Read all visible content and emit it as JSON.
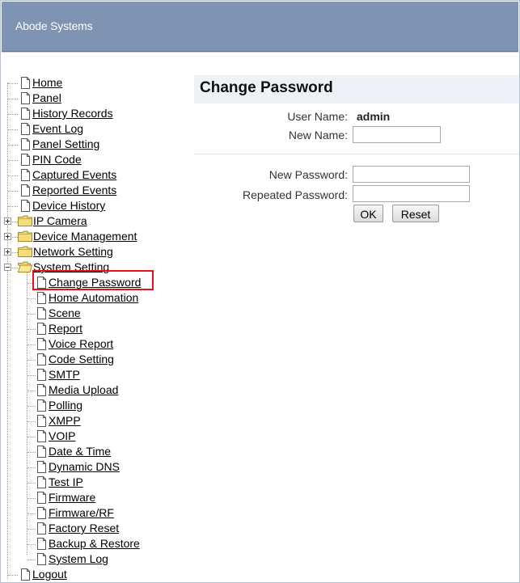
{
  "header": {
    "brand": "Abode Systems"
  },
  "tree": {
    "items": [
      {
        "label": "Home"
      },
      {
        "label": "Panel"
      },
      {
        "label": "History Records"
      },
      {
        "label": "Event Log"
      },
      {
        "label": "Panel Setting"
      },
      {
        "label": "PIN Code"
      },
      {
        "label": "Captured Events"
      },
      {
        "label": "Reported Events"
      },
      {
        "label": "Device History"
      },
      {
        "label": "IP Camera"
      },
      {
        "label": "Device Management"
      },
      {
        "label": "Network Setting"
      },
      {
        "label": "System Setting"
      }
    ],
    "children": [
      {
        "label": "Change Password"
      },
      {
        "label": "Home Automation"
      },
      {
        "label": "Scene"
      },
      {
        "label": "Report"
      },
      {
        "label": "Voice Report"
      },
      {
        "label": "Code Setting"
      },
      {
        "label": "SMTP"
      },
      {
        "label": "Media Upload"
      },
      {
        "label": "Polling"
      },
      {
        "label": "XMPP"
      },
      {
        "label": "VOIP"
      },
      {
        "label": "Date & Time"
      },
      {
        "label": "Dynamic DNS"
      },
      {
        "label": "Test IP"
      },
      {
        "label": "Firmware"
      },
      {
        "label": "Firmware/RF"
      },
      {
        "label": "Factory Reset"
      },
      {
        "label": "Backup & Restore"
      },
      {
        "label": "System Log"
      }
    ],
    "last": {
      "label": "Logout"
    }
  },
  "form": {
    "title": "Change Password",
    "user_name_label": "User Name:",
    "user_name_value": "admin",
    "new_name_label": "New Name:",
    "new_name_value": "",
    "new_password_label": "New Password:",
    "new_password_value": "",
    "repeated_password_label": "Repeated Password:",
    "repeated_password_value": "",
    "ok_label": "OK",
    "reset_label": "Reset"
  },
  "colors": {
    "header": "#7f93b3",
    "highlight": "#e5121b",
    "title_bar": "#eef2f7"
  }
}
